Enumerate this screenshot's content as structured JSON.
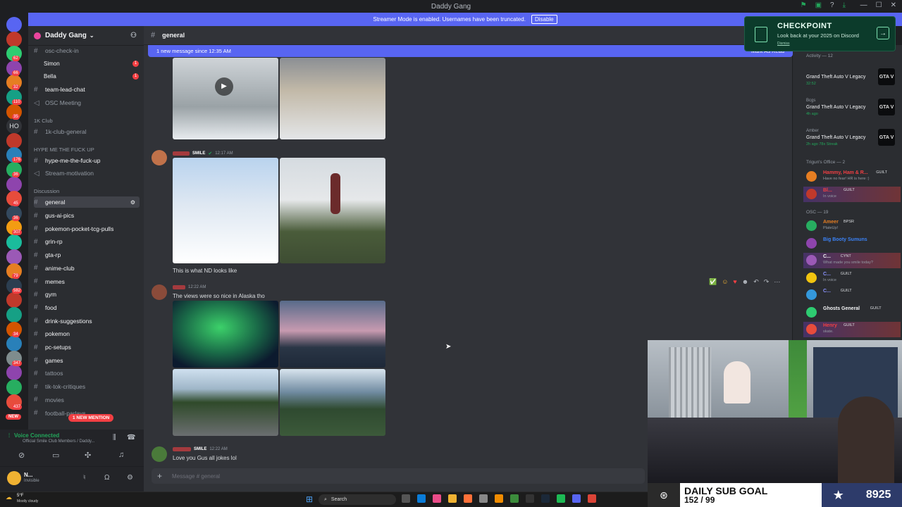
{
  "window": {
    "title": "Daddy Gang"
  },
  "banner": {
    "text": "Streamer Mode is enabled. Usernames have been truncated.",
    "button": "Disable"
  },
  "server": {
    "name": "Daddy Gang"
  },
  "server_badges": [
    "62",
    "66",
    "32",
    "110",
    "35",
    "176",
    "36",
    "45",
    "36",
    "307",
    "79",
    "582",
    "34",
    "347",
    "437"
  ],
  "channels": {
    "osc_check_in": "osc-check-in",
    "simon": "Simon",
    "bella": "Bella",
    "team_lead_chat": "team-lead-chat",
    "osc_meeting": "OSC Meeting",
    "cat_1k": "1K Club",
    "club_general": "1k-club-general",
    "cat_hype": "HYPE ME THE FUCK UP",
    "hype": "hype-me-the-fuck-up",
    "stream_motivation": "Stream-motivation",
    "cat_discussion": "Discussion",
    "general": "general",
    "gus_ai_pics": "gus-ai-pics",
    "pokemon_pocket": "pokemon-pocket-tcg-pulls",
    "grin_rp": "grin-rp",
    "gta_rp": "gta-rp",
    "anime_club": "anime-club",
    "memes": "memes",
    "gym": "gym",
    "food": "food",
    "drink_suggestions": "drink-suggestions",
    "pokemon": "pokemon",
    "pc_setups": "pc-setups",
    "games": "games",
    "tattoos": "tattoos",
    "tik_tok_critiques": "tik-tok-critiques",
    "movies": "movies",
    "football": "football-parlays",
    "new_mention": "1 NEW MENTION",
    "unread_1": "1",
    "unread_2": "1"
  },
  "voice": {
    "status": "Voice Connected",
    "location": "Official Smile Club Members / Daddy..."
  },
  "user": {
    "name": "N...",
    "status": "Invisible",
    "new_label": "NEW"
  },
  "header": {
    "channel": "general"
  },
  "new_messages": {
    "text": "1 new message since 12:35 AM",
    "mark": "Mark As Read"
  },
  "messages": [
    {
      "tag": "SMILE",
      "time": "12:17 AM",
      "text": "This is what ND looks like"
    },
    {
      "time": "12:22 AM",
      "text": "The views were so nice in Alaska tho"
    },
    {
      "tag": "SMILE",
      "time": "12:22 AM",
      "text": "Love you Gus all jokes lol"
    }
  ],
  "composer": {
    "placeholder": "Message #  general"
  },
  "checkpoint": {
    "title": "CHECKPOINT",
    "subtitle": "Look back at your 2025 on Discord",
    "dismiss": "Dismiss"
  },
  "members": {
    "activity_header": "Activity — 12",
    "activities": [
      {
        "who": "",
        "game": "Grand Theft Auto V Legacy",
        "time": "32:52"
      },
      {
        "who": "Bcgs",
        "game": "Grand Theft Auto V Legacy",
        "time": "4h ago"
      },
      {
        "who": "Amber",
        "game": "Grand Theft Auto V Legacy",
        "time": "2h ago  78x Streak"
      }
    ],
    "trigun_header": "Trigun's Office — 2",
    "trigun": [
      {
        "name": "Hammy, Ham & R...",
        "tag": "GUILT",
        "status": "Have no fear! HR is here :)"
      },
      {
        "name": "Bl...",
        "tag": "GUILT",
        "status": "In voice"
      }
    ],
    "osc_header": "OSC — 19",
    "osc": [
      {
        "name": "Ameer",
        "tag": "BPSR",
        "status": "PlateUp!"
      },
      {
        "name": "Big Booty Sumuns",
        "tag": "",
        "status": ""
      },
      {
        "name": "C...",
        "tag": "CYNT",
        "status": "What made you smile today?"
      },
      {
        "name": "C...",
        "tag": "GUILT",
        "status": "In voice"
      },
      {
        "name": "C...",
        "tag": "GUILT",
        "status": ""
      },
      {
        "name": "Ghosts General",
        "tag": "GUILT",
        "status": ""
      },
      {
        "name": "Henry",
        "tag": "GUILT",
        "status": "skate."
      }
    ]
  },
  "game_logo": "GTA V",
  "subgoal": {
    "title": "DAILY SUB GOAL",
    "progress": "152 / 99",
    "count": "8925"
  },
  "taskbar": {
    "weather_temp": "5°F",
    "weather_text": "Mostly cloudy",
    "search": "Search"
  },
  "colors": {
    "accent": "#5865f2",
    "danger": "#f23f43",
    "green": "#23a55a"
  }
}
